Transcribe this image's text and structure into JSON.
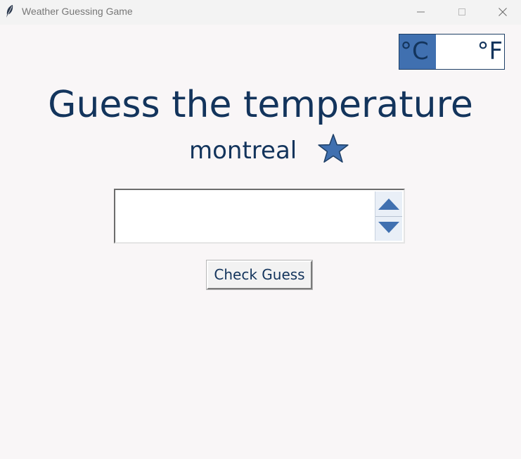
{
  "window": {
    "title": "Weather Guessing Game"
  },
  "unit_toggle": {
    "celsius_label": "°C",
    "fahrenheit_label": "°F",
    "selected": "°C"
  },
  "main": {
    "heading": "Guess the temperature",
    "city": "montreal",
    "guess_input_value": "",
    "check_button_label": "Check Guess"
  },
  "colors": {
    "accent": "#4070b0",
    "text": "#13345c",
    "background": "#f9f6f7"
  },
  "icons": {
    "app": "feather-icon",
    "favorite": "star-icon",
    "spin_up": "arrow-up-icon",
    "spin_down": "arrow-down-icon"
  }
}
